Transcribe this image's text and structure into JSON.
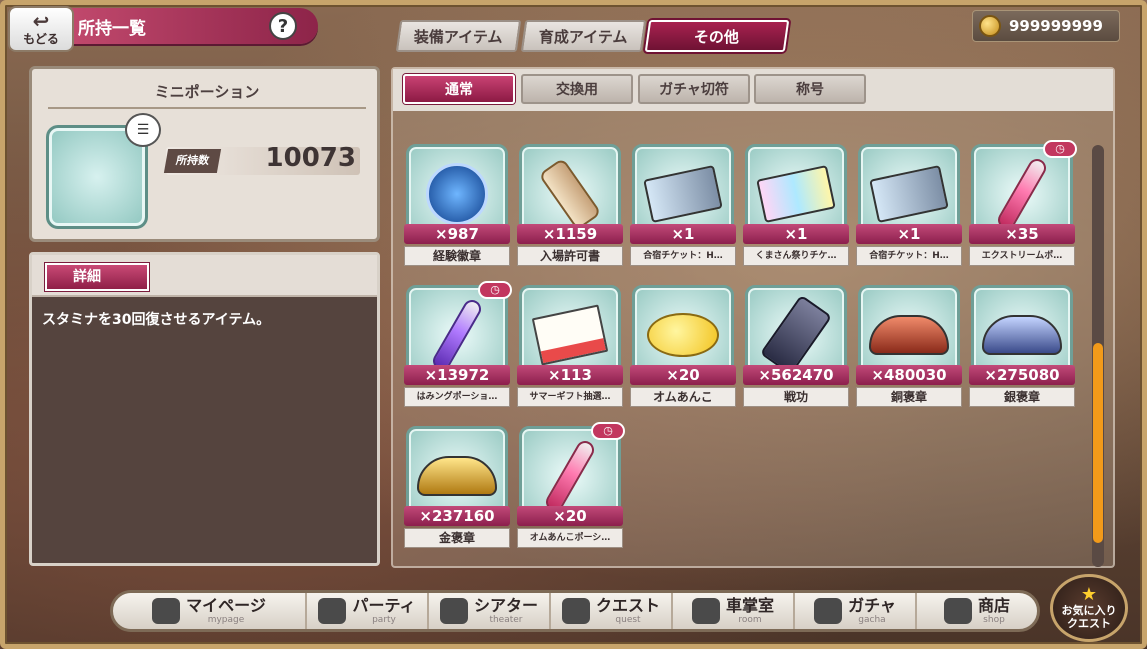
{
  "header": {
    "back_label": "もどる",
    "title": "所持一覧",
    "help": "?"
  },
  "main_tabs": [
    {
      "label": "装備アイテム",
      "active": false
    },
    {
      "label": "育成アイテム",
      "active": false
    },
    {
      "label": "その他",
      "active": true
    }
  ],
  "currency": {
    "amount": "999999999",
    "icon": "coin-icon"
  },
  "selected_item": {
    "name": "ミニポーション",
    "owned_label": "所持数",
    "owned_value": "10073",
    "detail_label": "詳細",
    "description": "スタミナを30回復させるアイテム。"
  },
  "sub_tabs": [
    {
      "label": "通常",
      "active": true
    },
    {
      "label": "交換用",
      "active": false
    },
    {
      "label": "ガチャ切符",
      "active": false
    },
    {
      "label": "称号",
      "active": false
    }
  ],
  "items": [
    {
      "name": "経験徽章",
      "count": "×987",
      "art": "medal",
      "timer": false
    },
    {
      "name": "入場許可書",
      "count": "×1159",
      "art": "scroll",
      "timer": false
    },
    {
      "name": "合宿チケット：H…",
      "count": "×1",
      "art": "ticket",
      "timer": false
    },
    {
      "name": "くまさん祭りチケ…",
      "count": "×1",
      "art": "ticket2",
      "timer": false
    },
    {
      "name": "合宿チケット：H…",
      "count": "×1",
      "art": "ticket",
      "timer": false
    },
    {
      "name": "エクストリームポ…",
      "count": "×35",
      "art": "potion",
      "timer": true
    },
    {
      "name": "はみングポーショ…",
      "count": "×13972",
      "art": "potion2",
      "timer": true
    },
    {
      "name": "サマーギフト抽選…",
      "count": "×113",
      "art": "letter",
      "timer": false
    },
    {
      "name": "オムあんこ",
      "count": "×20",
      "art": "lemon",
      "timer": false
    },
    {
      "name": "戦功",
      "count": "×562470",
      "art": "chip",
      "timer": false
    },
    {
      "name": "銅褒章",
      "count": "×480030",
      "art": "wings bronze",
      "timer": false
    },
    {
      "name": "銀褒章",
      "count": "×275080",
      "art": "wings silver",
      "timer": false
    },
    {
      "name": "金褒章",
      "count": "×237160",
      "art": "wings gold",
      "timer": false
    },
    {
      "name": "オムあんこポーシ…",
      "count": "×20",
      "art": "potion",
      "timer": true
    }
  ],
  "nav": [
    {
      "jp": "マイページ",
      "en": "mypage",
      "icon": "train-icon"
    },
    {
      "jp": "パーティ",
      "en": "party",
      "icon": "character-icon"
    },
    {
      "jp": "シアター",
      "en": "theater",
      "icon": "camera-icon"
    },
    {
      "jp": "クエスト",
      "en": "quest",
      "icon": "swords-icon"
    },
    {
      "jp": "車掌室",
      "en": "room",
      "icon": "quill-icon"
    },
    {
      "jp": "ガチャ",
      "en": "gacha",
      "icon": "ticket-icon"
    },
    {
      "jp": "商店",
      "en": "shop",
      "icon": "shopkeeper-icon"
    }
  ],
  "favorite_quest": {
    "line1": "お気に入り",
    "line2": "クエスト"
  }
}
